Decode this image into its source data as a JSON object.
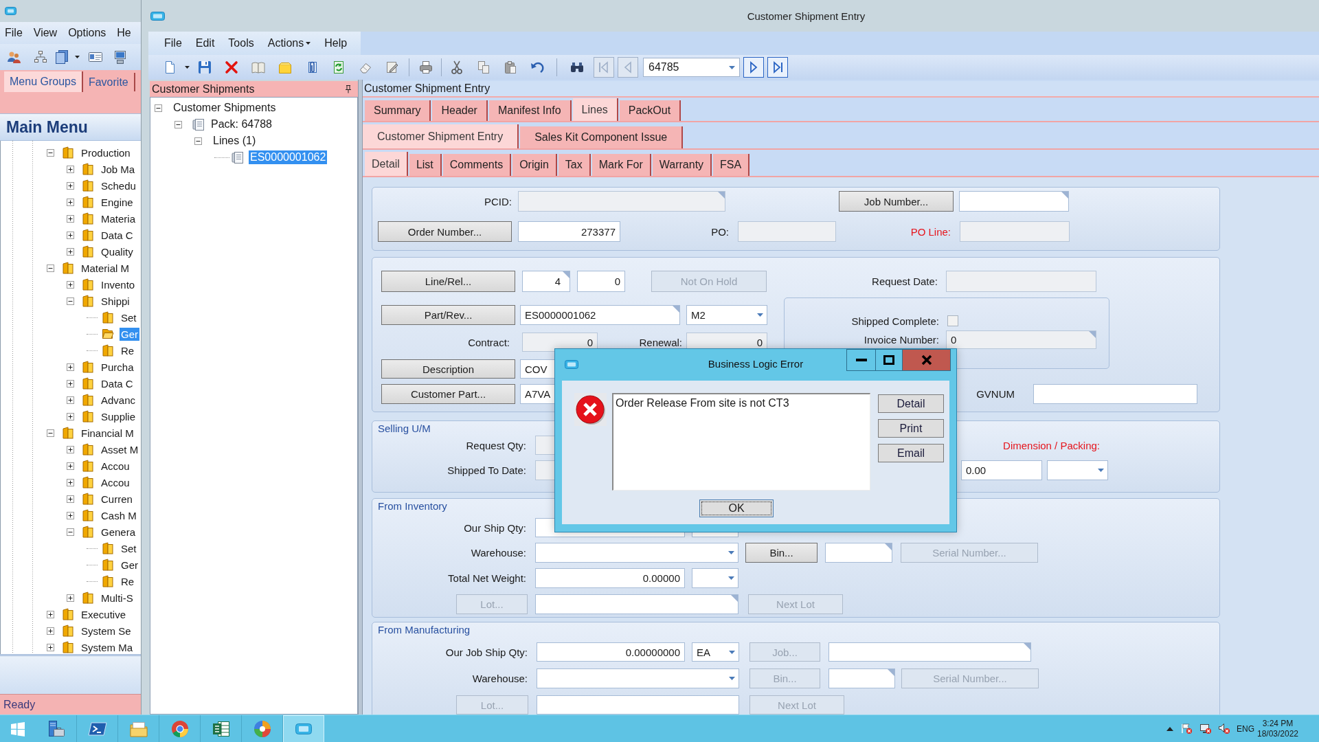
{
  "back_window": {
    "menu": [
      "File",
      "View",
      "Options",
      "He"
    ],
    "tabs": [
      {
        "label": "Menu Groups",
        "selected": true
      },
      {
        "label": "Favorite",
        "selected": false
      }
    ],
    "header": "Main Menu",
    "tree": [
      {
        "label": "Production",
        "expanded": true,
        "selected": false,
        "children": [
          {
            "label": "Job Ma",
            "expanded": false,
            "selected": false
          },
          {
            "label": "Schedu",
            "expanded": false,
            "selected": false
          },
          {
            "label": "Engine",
            "expanded": false,
            "selected": false
          },
          {
            "label": "Materia",
            "expanded": false,
            "selected": false
          },
          {
            "label": "Data C",
            "expanded": false,
            "selected": false
          },
          {
            "label": "Quality",
            "expanded": false,
            "selected": false
          }
        ]
      },
      {
        "label": "Material M",
        "expanded": true,
        "selected": false,
        "children": [
          {
            "label": "Invento",
            "expanded": false,
            "selected": false
          },
          {
            "label": "Shippi",
            "expanded": true,
            "selected": false,
            "children": [
              {
                "label": "Set",
                "selected": false
              },
              {
                "label": "Ger",
                "selected": true
              },
              {
                "label": "Re",
                "selected": false
              }
            ]
          },
          {
            "label": "Purcha",
            "expanded": false,
            "selected": false
          },
          {
            "label": "Data C",
            "expanded": false,
            "selected": false
          },
          {
            "label": "Advanc",
            "expanded": false,
            "selected": false
          },
          {
            "label": "Supplie",
            "expanded": false,
            "selected": false
          }
        ]
      },
      {
        "label": "Financial M",
        "expanded": true,
        "selected": false,
        "children": [
          {
            "label": "Asset M",
            "expanded": false,
            "selected": false
          },
          {
            "label": "Accou",
            "expanded": false,
            "selected": false
          },
          {
            "label": "Accou",
            "expanded": false,
            "selected": false
          },
          {
            "label": "Curren",
            "expanded": false,
            "selected": false
          },
          {
            "label": "Cash M",
            "expanded": false,
            "selected": false
          },
          {
            "label": "Genera",
            "expanded": true,
            "selected": false,
            "children": [
              {
                "label": "Set",
                "selected": false
              },
              {
                "label": "Ger",
                "selected": false
              },
              {
                "label": "Re",
                "selected": false
              }
            ]
          },
          {
            "label": "Multi-S",
            "expanded": false,
            "selected": false
          }
        ]
      },
      {
        "label": "Executive",
        "expanded": false,
        "selected": false
      },
      {
        "label": "System Se",
        "expanded": false,
        "selected": false
      },
      {
        "label": "System Ma",
        "expanded": false,
        "selected": false
      }
    ],
    "status": "Ready"
  },
  "main_window": {
    "title": "Customer Shipment Entry",
    "menu": [
      {
        "label": "File",
        "dropdown": false
      },
      {
        "label": "Edit",
        "dropdown": false
      },
      {
        "label": "Tools",
        "dropdown": false
      },
      {
        "label": "Actions",
        "dropdown": true
      },
      {
        "label": "Help",
        "dropdown": false
      }
    ],
    "nav": [
      {
        "kind": "first",
        "disabled": true
      },
      {
        "kind": "previous",
        "disabled": true
      },
      {
        "kind": "next",
        "disabled": false
      },
      {
        "kind": "last",
        "disabled": false
      }
    ],
    "record": "64785",
    "tree_panel": {
      "title": "Customer Shipments",
      "tree": [
        {
          "label": "Customer Shipments",
          "expanded": true,
          "selected": false,
          "children": [
            {
              "label": "Pack: 64788",
              "kind": "record",
              "expanded": true,
              "selected": false,
              "children": [
                {
                  "label": "Lines (1)",
                  "expanded": true,
                  "selected": false,
                  "children": [
                    {
                      "label": "ES0000001062",
                      "kind": "record",
                      "selected": true
                    }
                  ]
                }
              ]
            }
          ]
        }
      ]
    },
    "form_title": "Customer Shipment Entry",
    "tab_rows": [
      [
        {
          "label": "Summary",
          "selected": false
        },
        {
          "label": "Header",
          "selected": false
        },
        {
          "label": "Manifest Info",
          "selected": false
        },
        {
          "label": "Lines",
          "selected": true
        },
        {
          "label": "PackOut",
          "selected": false
        }
      ],
      [
        {
          "label": "Customer Shipment Entry",
          "selected": true
        },
        {
          "label": "Sales Kit Component Issue",
          "selected": false
        }
      ],
      [
        {
          "label": "Detail",
          "selected": true
        },
        {
          "label": "List",
          "selected": false
        },
        {
          "label": "Comments",
          "selected": false
        },
        {
          "label": "Origin",
          "selected": false
        },
        {
          "label": "Tax",
          "selected": false
        },
        {
          "label": "Mark For",
          "selected": false
        },
        {
          "label": "Warranty",
          "selected": false
        },
        {
          "label": "FSA",
          "selected": false
        }
      ]
    ],
    "groups": [
      {
        "rows": [
          [
            {
              "kind": "label",
              "text": "PCID:",
              "required": false
            },
            {
              "kind": "field",
              "disabled": true,
              "lookup": true
            },
            {
              "kind": "button",
              "text": "Job Number...",
              "disabled": false
            },
            {
              "kind": "field",
              "disabled": false,
              "lookup": true
            }
          ],
          [
            {
              "kind": "button",
              "text": "Order Number...",
              "disabled": false
            },
            {
              "kind": "number",
              "value": "273377",
              "disabled": false,
              "lookup": false
            },
            {
              "kind": "label",
              "text": "PO:",
              "required": false
            },
            {
              "kind": "field",
              "disabled": true,
              "lookup": false
            },
            {
              "kind": "label",
              "text": "PO Line:",
              "required": true
            },
            {
              "kind": "field",
              "disabled": true,
              "lookup": false
            }
          ]
        ]
      },
      {
        "rows": [
          [
            {
              "kind": "button",
              "text": "Line/Rel...",
              "disabled": false
            },
            {
              "kind": "number",
              "value": "4",
              "disabled": false,
              "lookup": true
            },
            {
              "kind": "number",
              "value": "0",
              "disabled": false,
              "lookup": false
            },
            {
              "kind": "button",
              "text": "Not On Hold",
              "disabled": true
            },
            {
              "kind": "label",
              "text": "Request Date:",
              "required": false
            },
            {
              "kind": "field",
              "disabled": true,
              "lookup": false
            }
          ],
          [
            {
              "kind": "button",
              "text": "Part/Rev...",
              "disabled": false
            },
            {
              "kind": "field",
              "value": "ES0000001062",
              "disabled": false,
              "lookup": true
            },
            {
              "kind": "combo",
              "value": "M2",
              "disabled": false
            }
          ],
          [
            {
              "kind": "label",
              "text": "Contract:",
              "required": false
            },
            {
              "kind": "number",
              "value": "0",
              "disabled": true,
              "lookup": false
            },
            {
              "kind": "label",
              "text": "Renewal:",
              "required": false
            },
            {
              "kind": "number",
              "value": "0",
              "disabled": true,
              "lookup": false
            }
          ],
          [
            {
              "kind": "button",
              "text": "Description",
              "disabled": false
            },
            {
              "kind": "field",
              "value": "COV",
              "disabled": false
            }
          ],
          [
            {
              "kind": "button",
              "text": "Customer Part...",
              "disabled": false
            },
            {
              "kind": "field",
              "value": "A7VA",
              "disabled": false
            },
            {
              "kind": "label",
              "text": "GVNUM",
              "required": false
            },
            {
              "kind": "field",
              "disabled": false,
              "lookup": false
            }
          ]
        ],
        "panel": {
          "rows": [
            [
              {
                "kind": "label",
                "text": "Shipped Complete:",
                "required": false
              },
              {
                "kind": "checkbox",
                "checked": false,
                "disabled": true
              }
            ],
            [
              {
                "kind": "label",
                "text": "Invoice Number:",
                "required": false
              },
              {
                "kind": "field",
                "value": "0",
                "disabled": true,
                "lookup": true
              }
            ]
          ]
        }
      },
      {
        "title": "Selling U/M",
        "rows": [
          [
            {
              "kind": "label",
              "text": "Request Qty:",
              "required": false
            },
            {
              "kind": "field",
              "disabled": true
            },
            {
              "kind": "label",
              "text": "Dimension / Packing:",
              "required": true
            }
          ],
          [
            {
              "kind": "label",
              "text": "Shipped To Date:",
              "required": false
            },
            {
              "kind": "field",
              "disabled": true
            },
            {
              "kind": "field",
              "value": "0.00",
              "disabled": false,
              "lookup": false
            },
            {
              "kind": "combo",
              "disabled": false
            }
          ]
        ]
      },
      {
        "title": "From Inventory",
        "rows": [
          [
            {
              "kind": "label",
              "text": "Our Ship Qty:",
              "required": false
            },
            {
              "kind": "field",
              "disabled": false
            },
            {
              "kind": "combo",
              "disabled": false
            }
          ],
          [
            {
              "kind": "label",
              "text": "Warehouse:",
              "required": false
            },
            {
              "kind": "combo",
              "disabled": false
            },
            {
              "kind": "button",
              "text": "Bin...",
              "disabled": false
            },
            {
              "kind": "field",
              "disabled": false,
              "lookup": true
            },
            {
              "kind": "button",
              "text": "Serial Number...",
              "disabled": true
            }
          ],
          [
            {
              "kind": "label",
              "text": "Total Net Weight:",
              "required": false
            },
            {
              "kind": "number",
              "value": "0.00000",
              "disabled": false,
              "lookup": false
            },
            {
              "kind": "combo",
              "disabled": false
            }
          ],
          [
            {
              "kind": "button",
              "text": "Lot...",
              "disabled": true
            },
            {
              "kind": "field",
              "disabled": false,
              "lookup": true
            },
            {
              "kind": "button",
              "text": "Next Lot",
              "disabled": true
            }
          ]
        ]
      },
      {
        "title": "From Manufacturing",
        "rows": [
          [
            {
              "kind": "label",
              "text": "Our Job Ship Qty:",
              "required": false
            },
            {
              "kind": "number",
              "value": "0.00000000",
              "disabled": false,
              "lookup": false
            },
            {
              "kind": "combo",
              "value": "EA",
              "disabled": false
            },
            {
              "kind": "button",
              "text": "Job...",
              "disabled": true
            },
            {
              "kind": "field",
              "disabled": false,
              "lookup": true
            }
          ],
          [
            {
              "kind": "label",
              "text": "Warehouse:",
              "required": false
            },
            {
              "kind": "combo",
              "disabled": false
            },
            {
              "kind": "button",
              "text": "Bin...",
              "disabled": true
            },
            {
              "kind": "field",
              "disabled": false,
              "lookup": true
            },
            {
              "kind": "button",
              "text": "Serial Number...",
              "disabled": true
            }
          ],
          [
            {
              "kind": "button",
              "text": "Lot...",
              "disabled": true
            },
            {
              "kind": "field",
              "disabled": false,
              "lookup": false
            },
            {
              "kind": "button",
              "text": "Next Lot",
              "disabled": true
            }
          ]
        ]
      }
    ]
  },
  "dialog": {
    "title": "Business Logic Error",
    "message": "Order Release From site is not CT3",
    "buttons": [
      "Detail",
      "Print",
      "Email"
    ],
    "ok": {
      "label": "OK",
      "focused": true
    }
  },
  "taskbar": {
    "apps": [
      {
        "kind": "server_manager",
        "active": false
      },
      {
        "kind": "terminal",
        "active": false
      },
      {
        "kind": "explorer",
        "active": false
      },
      {
        "kind": "browser",
        "active": false
      },
      {
        "kind": "spreadsheet",
        "active": false
      },
      {
        "kind": "color_wheel",
        "active": false
      },
      {
        "kind": "app",
        "active": true
      }
    ],
    "language": "ENG",
    "time": "3:24 PM",
    "date": "18/03/2022"
  }
}
